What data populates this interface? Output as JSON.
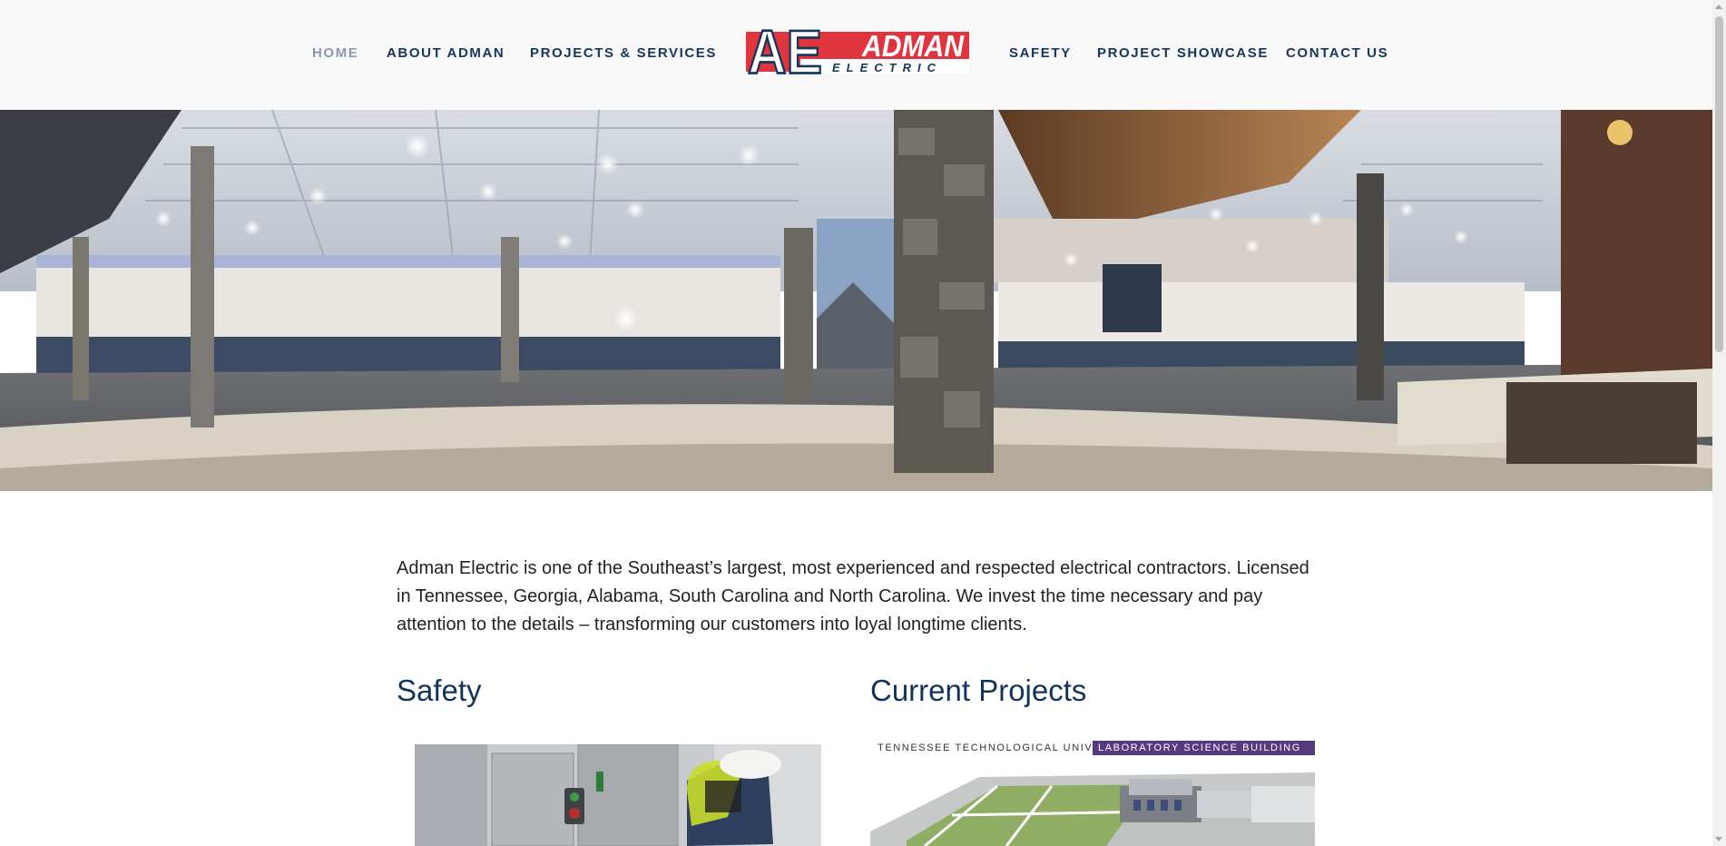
{
  "nav": {
    "items": [
      {
        "label": "HOME",
        "active": true
      },
      {
        "label": "ABOUT ADMAN"
      },
      {
        "label": "PROJECTS & SERVICES"
      },
      {
        "label": "SAFETY"
      },
      {
        "label": "PROJECT SHOWCASE"
      },
      {
        "label": "CONTACT US"
      }
    ]
  },
  "logo": {
    "monogram": "AE",
    "name": "ADMAN",
    "sub": "ELECTRIC"
  },
  "hero": {
    "icon": "panorama-interior-image"
  },
  "intro": {
    "text": "Adman Electric is one of the Southeast’s largest, most experienced and respected electrical contractors. Licensed in Tennessee, Georgia, Alabama, South Carolina and North Carolina. We invest the time necessary and pay attention to the details – transforming our customers into loyal longtime clients."
  },
  "sections": {
    "safety": {
      "title": "Safety"
    },
    "projects": {
      "title": "Current Projects",
      "image_caption_left": "TENNESSEE TECHNOLOGICAL UNIVERSITY",
      "image_caption_right": "LABORATORY SCIENCE BUILDING"
    }
  },
  "colors": {
    "brand_red": "#e0343f",
    "brand_navy": "#16365c",
    "purple_banner": "#553a7c"
  }
}
